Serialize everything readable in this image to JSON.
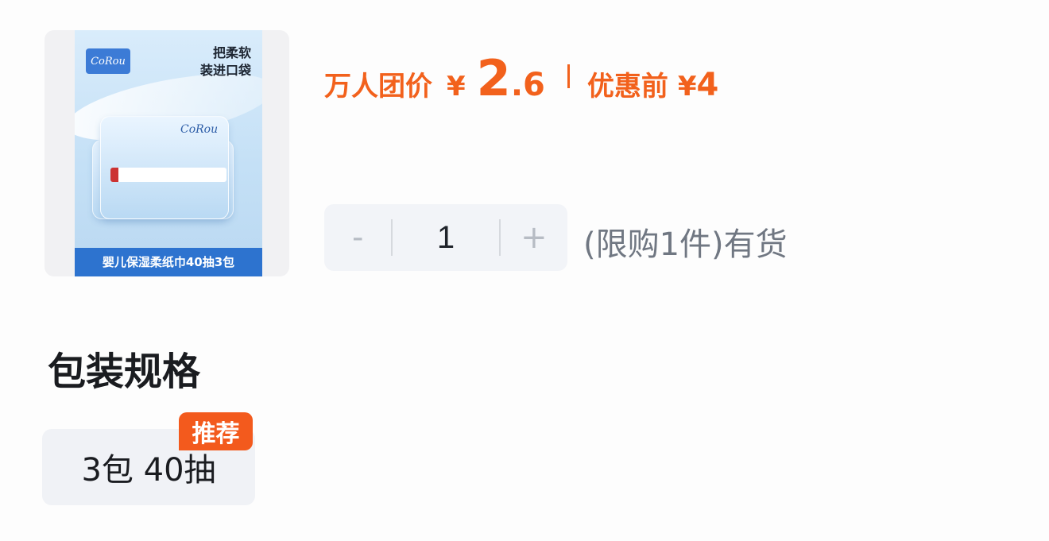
{
  "product": {
    "image": {
      "slogan_line1": "把柔软",
      "slogan_line2": "装进口袋",
      "brand": "CoRou",
      "caption": "婴儿保湿柔纸巾40抽3包"
    },
    "price": {
      "group_label": "万人团价",
      "currency": "¥",
      "group_price_int": "2",
      "group_price_dec": ".6",
      "original_label": "优惠前",
      "original_currency": "¥",
      "original_price": "4",
      "accent_color": "#f2611c"
    },
    "quantity": {
      "minus": "-",
      "value": "1",
      "plus": "+",
      "stock_text": "(限购1件)有货"
    }
  },
  "spec": {
    "title": "包装规格",
    "options": [
      {
        "label": "3包 40抽",
        "badge": "推荐"
      }
    ]
  }
}
